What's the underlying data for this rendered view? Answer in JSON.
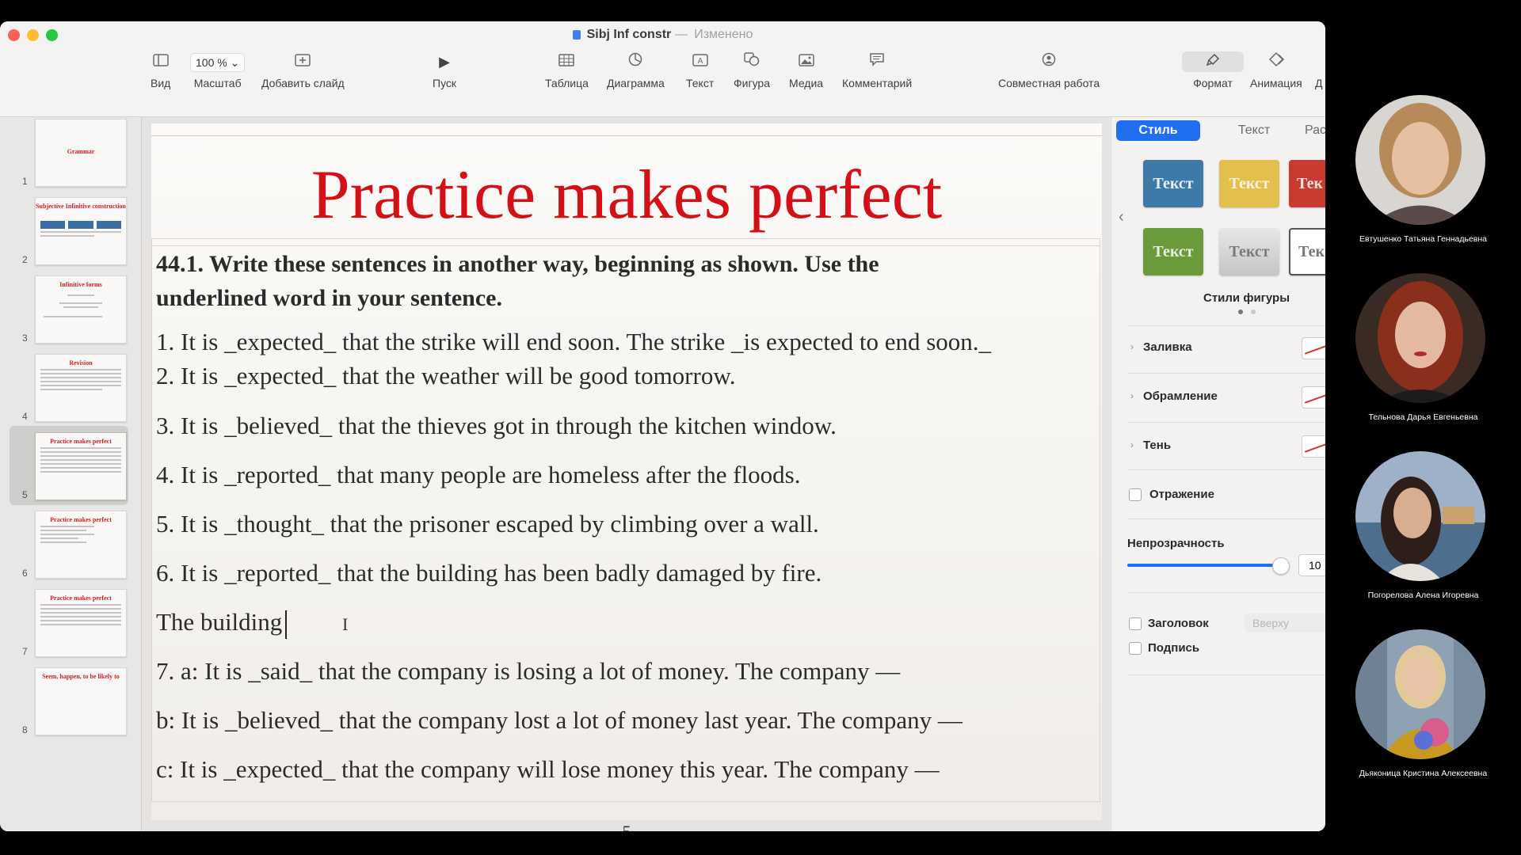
{
  "window": {
    "doc_title": "Sibj Inf constr",
    "separator": "—",
    "status": "Изменено"
  },
  "toolbar": {
    "view": "Вид",
    "zoom_value": "100 %",
    "zoom": "Масштаб",
    "add_slide": "Добавить слайд",
    "play": "Пуск",
    "table": "Таблица",
    "chart": "Диаграмма",
    "text": "Текст",
    "shape": "Фигура",
    "media": "Медиа",
    "comment": "Комментарий",
    "collaborate": "Совместная работа",
    "format": "Формат",
    "animate": "Анимация",
    "document_cut": "Д"
  },
  "sidebar": {
    "slides": [
      {
        "num": "1",
        "title": "Grammar"
      },
      {
        "num": "2",
        "title": "Subjective Infinitive construction"
      },
      {
        "num": "3",
        "title": "Infinitive forms"
      },
      {
        "num": "4",
        "title": "Revision"
      },
      {
        "num": "5",
        "title": "Practice makes perfect"
      },
      {
        "num": "6",
        "title": "Practice makes perfect"
      },
      {
        "num": "7",
        "title": "Practice makes perfect"
      },
      {
        "num": "8",
        "title": "Seem, happen, to be likely to"
      }
    ]
  },
  "slide": {
    "title": "Practice makes perfect",
    "heading_line1": "44.1. Write these sentences in another way, beginning as shown. Use the",
    "heading_line2": "underlined word in your sentence.",
    "lines": [
      "1. It is _expected_ that the strike will end soon. The strike _is expected to end soon._",
      "2. It is _expected_ that the weather will be good tomorrow.",
      "3. It is _believed_ that the thieves got in through the kitchen window.",
      "4. It is _reported_ that many people are homeless after the floods.",
      "5. It is _thought_ that the prisoner escaped by climbing over a wall.",
      "6. It is _reported_ that the building has been badly damaged by fire.",
      "The building",
      "7. a: It is _said_ that the company is losing a lot of money. The company —",
      "b: It is _believed_ that the company lost a lot of money last year. The company —",
      "c: It is _expected_ that the company will lose money this year. The company —"
    ],
    "page_number": "5"
  },
  "inspector": {
    "tabs": [
      "Стиль",
      "Текст",
      "Расс"
    ],
    "swatch_label": "Текст",
    "swatch_label_cut": "Тек",
    "shape_styles": "Стили фигуры",
    "fill": "Заливка",
    "border": "Обрамление",
    "shadow": "Тень",
    "reflection": "Отражение",
    "opacity": "Непрозрачность",
    "opacity_value": "10",
    "opacity_fraction": 1.0,
    "title": "Заголовок",
    "title_position": "Вверху",
    "caption": "Подпись",
    "accent_color": "#1f6ff0"
  },
  "participants": [
    {
      "name": "Евтушенко Татьяна Геннадьевна"
    },
    {
      "name": "Тельнова Дарья Евгеньевна"
    },
    {
      "name": "Погорелова Алена Игоревна"
    },
    {
      "name": "Дьяконица Кристина Алексеевна"
    }
  ]
}
